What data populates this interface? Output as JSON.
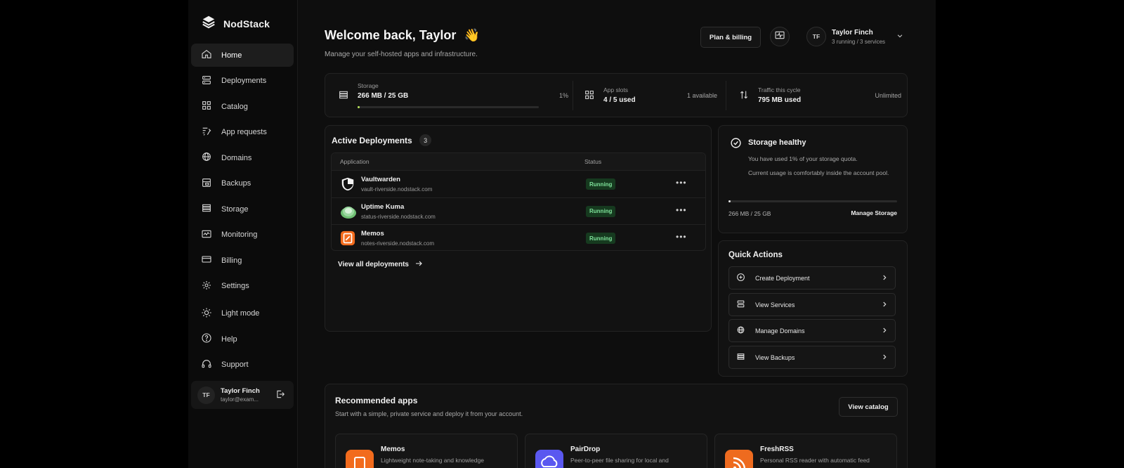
{
  "brand": {
    "name": "NodStack"
  },
  "sidebar": {
    "items": [
      {
        "label": "Home",
        "icon": "home-icon",
        "active": true
      },
      {
        "label": "Deployments",
        "icon": "deployments-icon"
      },
      {
        "label": "Catalog",
        "icon": "grid-icon"
      },
      {
        "label": "App requests",
        "icon": "request-icon"
      },
      {
        "label": "Domains",
        "icon": "globe-icon"
      },
      {
        "label": "Backups",
        "icon": "backup-icon"
      },
      {
        "label": "Storage",
        "icon": "storage-icon"
      },
      {
        "label": "Monitoring",
        "icon": "monitor-icon"
      },
      {
        "label": "Billing",
        "icon": "card-icon"
      },
      {
        "label": "Settings",
        "icon": "gear-icon"
      }
    ],
    "extra": [
      {
        "label": "Light mode",
        "icon": "sun-icon"
      },
      {
        "label": "Help",
        "icon": "help-icon"
      },
      {
        "label": "Support",
        "icon": "headset-icon"
      }
    ],
    "user": {
      "initials": "TF",
      "name": "Taylor Finch",
      "email": "taylor@exam..."
    }
  },
  "header": {
    "title": "Welcome back, Taylor",
    "wave": "👋",
    "subtitle": "Manage your self-hosted apps and infrastructure.",
    "plan_button": "Plan & billing",
    "user": {
      "initials": "TF",
      "name": "Taylor Finch",
      "sub": "3 running / 3 services"
    }
  },
  "stats": {
    "storage": {
      "label": "Storage",
      "value": "266 MB / 25 GB",
      "percent_text": "1%",
      "fill": 0.01
    },
    "slots": {
      "label": "App slots",
      "value": "4 / 5 used",
      "right": "1 available"
    },
    "traffic": {
      "label": "Traffic this cycle",
      "value": "795 MB used",
      "right": "Unlimited"
    }
  },
  "deployments": {
    "title": "Active Deployments",
    "count": "3",
    "columns": {
      "application": "Application",
      "status": "Status"
    },
    "rows": [
      {
        "name": "Vaultwarden",
        "url": "vault-riverside.nodstack.com",
        "status": "Running",
        "icon": "shield-icon"
      },
      {
        "name": "Uptime Kuma",
        "url": "status-riverside.nodstack.com",
        "status": "Running",
        "icon": "kuma-icon"
      },
      {
        "name": "Memos",
        "url": "notes-riverside.nodstack.com",
        "status": "Running",
        "icon": "memos-icon"
      }
    ],
    "view_all": "View all deployments"
  },
  "storage_health": {
    "title": "Storage healthy",
    "line1": "You have used 1% of your storage quota.",
    "line2": "Current usage is comfortably inside the account pool.",
    "usage": "266 MB / 25 GB",
    "manage": "Manage Storage",
    "fill": 0.01
  },
  "quick_actions": {
    "title": "Quick Actions",
    "items": [
      {
        "label": "Create Deployment",
        "icon": "plus-circle-icon"
      },
      {
        "label": "View Services",
        "icon": "server-icon"
      },
      {
        "label": "Manage Domains",
        "icon": "globe-icon"
      },
      {
        "label": "View Backups",
        "icon": "list-icon"
      }
    ]
  },
  "recommended": {
    "title": "Recommended apps",
    "subtitle": "Start with a simple, private service and deploy it from your account.",
    "catalog_button": "View catalog",
    "apps": [
      {
        "name": "Memos",
        "desc": "Lightweight note-taking and knowledge",
        "color": "#f26b1d"
      },
      {
        "name": "PairDrop",
        "desc": "Peer-to-peer file sharing for local and",
        "color": "#5a58f0"
      },
      {
        "name": "FreshRSS",
        "desc": "Personal RSS reader with automatic feed",
        "color": "#ee6b1f"
      }
    ]
  },
  "colors": {
    "accent_green": "#7ee29a",
    "status_bg": "#163a1f",
    "progress": "#b7e35a"
  }
}
